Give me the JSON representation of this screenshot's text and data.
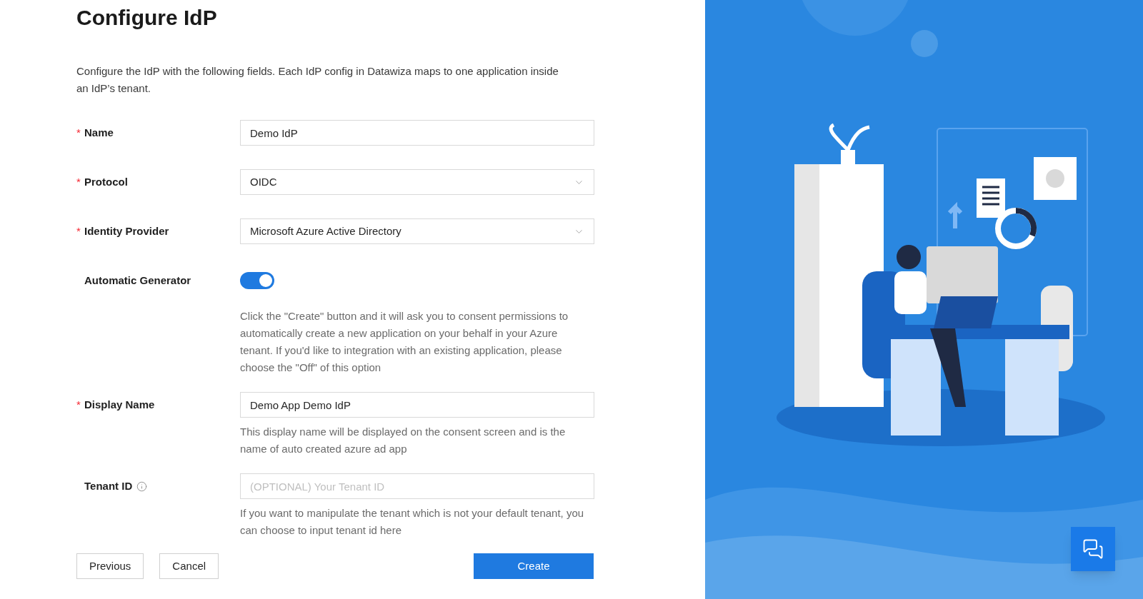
{
  "title": "Configure IdP",
  "description": "Configure the IdP with the following fields. Each IdP config in Datawiza maps to one application inside an IdP’s tenant.",
  "fields": [
    {
      "kind": "text",
      "label": "Name",
      "required_mark": "*",
      "value": "Demo IdP"
    },
    {
      "kind": "select",
      "label": "Protocol",
      "required_mark": "*",
      "value": "OIDC"
    },
    {
      "kind": "select",
      "label": "Identity Provider",
      "required_mark": "*",
      "value": "Microsoft Azure Active Directory"
    },
    {
      "kind": "toggle",
      "label": "Automatic Generator",
      "on": true,
      "help": "Click the \"Create\" button and it will ask you to consent permissions to automatically create a new application on your behalf in your Azure tenant. If you'd like to integration with an existing application, please choose the \"Off\" of this option"
    },
    {
      "kind": "text",
      "label": "Display Name",
      "required_mark": "*",
      "value": "Demo App Demo IdP",
      "help": "This display name will be displayed on the consent screen and is the name of auto created azure ad app"
    },
    {
      "kind": "text",
      "label": "Tenant ID",
      "info": true,
      "placeholder": "(OPTIONAL) Your Tenant ID",
      "help": "If you want to manipulate the tenant which is not your default tenant, you can choose to input tenant id here"
    }
  ],
  "buttons": [
    {
      "label": "Previous",
      "kind": "default"
    },
    {
      "label": "Cancel",
      "kind": "default"
    },
    {
      "label": "Create",
      "kind": "primary"
    }
  ]
}
